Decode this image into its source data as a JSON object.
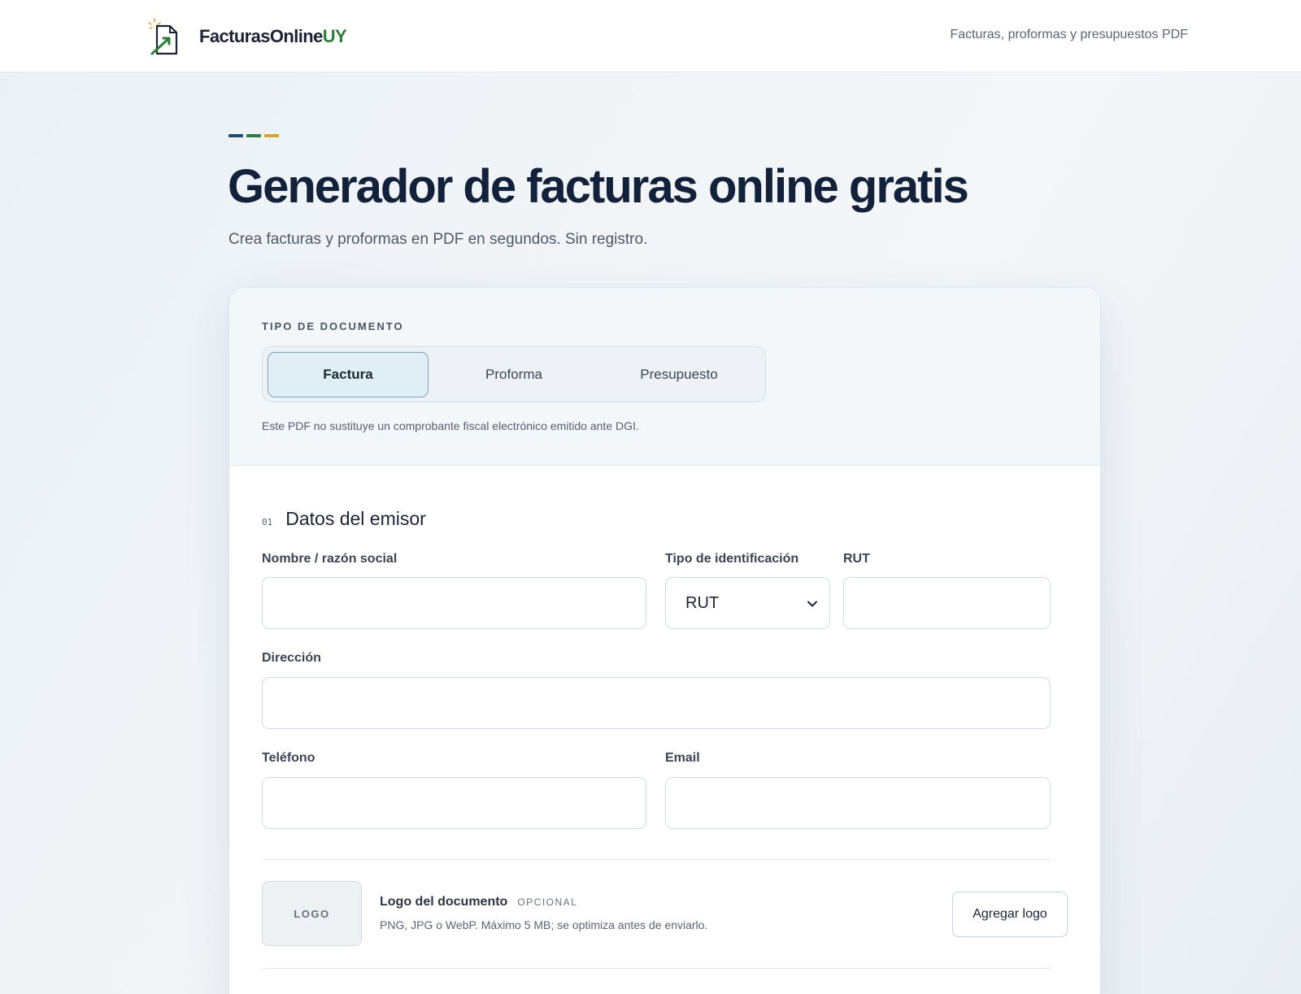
{
  "header": {
    "brand_main": "FacturasOnline",
    "brand_accent": "UY",
    "tagline": "Facturas, proformas y presupuestos PDF"
  },
  "hero": {
    "title": "Generador de facturas online gratis",
    "subtitle": "Crea facturas y proformas en PDF en segundos. Sin registro.",
    "dash_colors": [
      "#1d4e6e",
      "#2f7d3a",
      "#d4a52e"
    ]
  },
  "doc_type": {
    "label": "TIPO DE DOCUMENTO",
    "options": [
      "Factura",
      "Proforma",
      "Presupuesto"
    ],
    "selected": "Factura",
    "disclaimer": "Este PDF no sustituye un comprobante fiscal electrónico emitido ante DGI."
  },
  "issuer": {
    "number": "01",
    "title": "Datos del emisor",
    "fields": {
      "name_label": "Nombre / razón social",
      "name_value": "",
      "id_type_label": "Tipo de identificación",
      "id_type_value": "RUT",
      "id_label": "RUT",
      "id_value": "",
      "address_label": "Dirección",
      "address_value": "",
      "phone_label": "Teléfono",
      "phone_value": "",
      "email_label": "Email",
      "email_value": ""
    },
    "logo": {
      "placeholder": "LOGO",
      "title": "Logo del documento",
      "optional": "OPCIONAL",
      "hint": "PNG, JPG o WebP. Máximo 5 MB; se optimiza antes de enviarlo.",
      "button": "Agregar logo"
    }
  },
  "colors": {
    "brand_dark": "#1b2333",
    "brand_green": "#2f7d3a",
    "selected_tab_border": "#7ea6bf"
  },
  "icons": {
    "brand": "document-arrow-icon",
    "select": "chevron-down-icon"
  }
}
